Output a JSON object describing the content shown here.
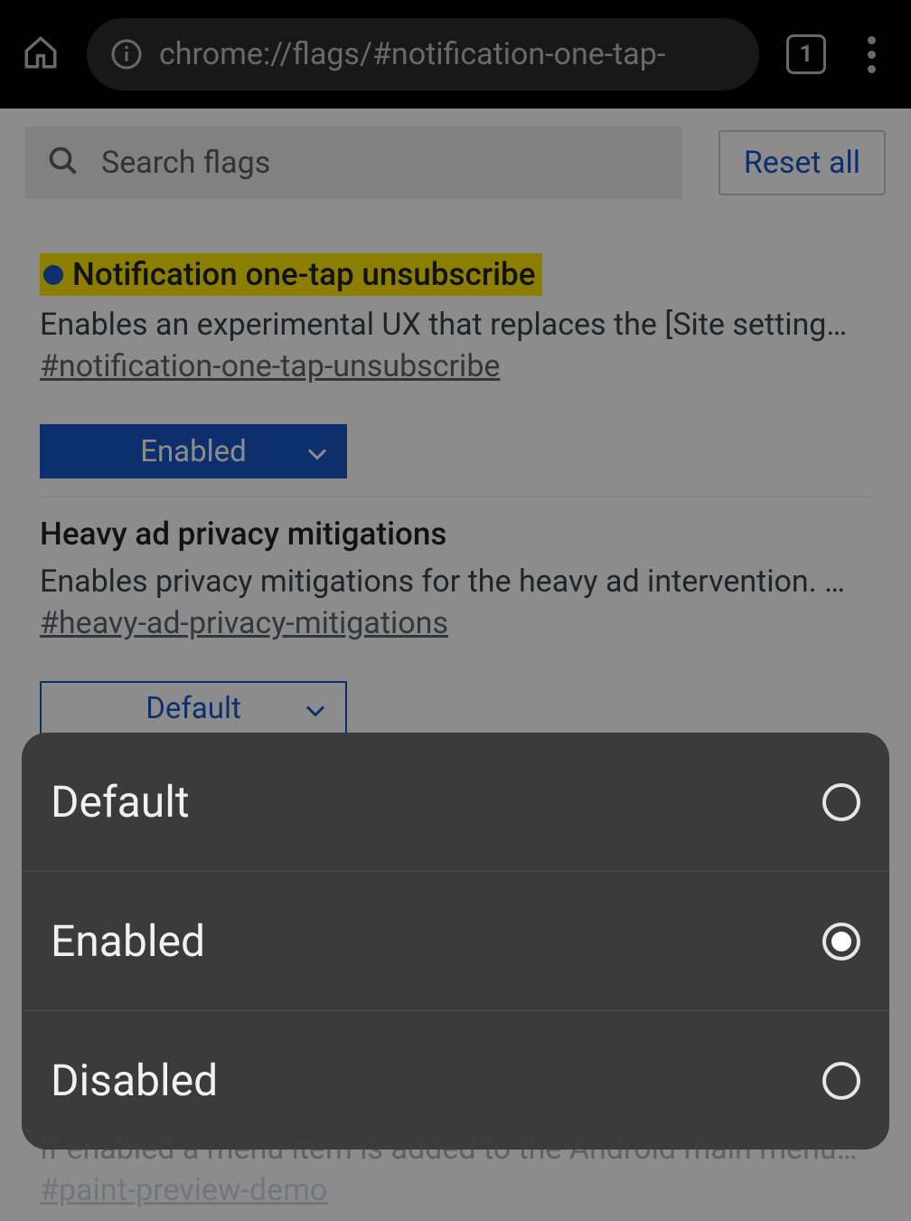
{
  "browser": {
    "url": "chrome://flags/#notification-one-tap-",
    "tab_count": "1"
  },
  "toolbar": {
    "search_placeholder": "Search flags",
    "reset_label": "Reset all"
  },
  "flags": [
    {
      "title": "Notification one-tap unsubscribe",
      "desc": "Enables an experimental UX that replaces the [Site settings] button o…",
      "hash": "#notification-one-tap-unsubscribe",
      "select_value": "Enabled",
      "select_style": "filled",
      "highlighted": true
    },
    {
      "title": "Heavy ad privacy mitigations",
      "desc": "Enables privacy mitigations for the heavy ad intervention. Disabling t…",
      "hash": "#heavy-ad-privacy-mitigations",
      "select_value": "Default",
      "select_style": "outline",
      "highlighted": false
    }
  ],
  "peek_flag": {
    "desc": "If enabled a menu item is added to the Android main menu to demo …",
    "hash": "#paint-preview-demo"
  },
  "sheet": {
    "options": [
      "Default",
      "Enabled",
      "Disabled"
    ],
    "selected": "Enabled"
  }
}
